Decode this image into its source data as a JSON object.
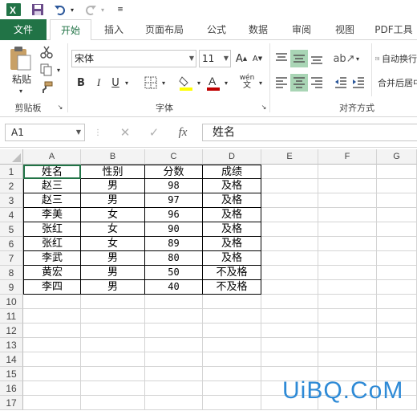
{
  "qab": {
    "app_icon": "excel-logo-icon",
    "save_icon": "save-icon",
    "undo_icon": "undo-icon",
    "redo_icon": "redo-icon",
    "customize_icon": "customize-qab-icon"
  },
  "tabs": [
    "文件",
    "开始",
    "插入",
    "页面布局",
    "公式",
    "数据",
    "审阅",
    "视图",
    "PDF工具"
  ],
  "ribbon": {
    "clipboard": {
      "paste_label": "粘贴",
      "group_label": "剪贴板"
    },
    "font": {
      "font_name": "宋体",
      "font_size": "11",
      "bold": "B",
      "italic": "I",
      "underline": "U",
      "phonetic": "wén",
      "group_label": "字体"
    },
    "alignment": {
      "wrap_label": "自动换行",
      "merge_label": "合并后居中",
      "group_label": "对齐方式"
    }
  },
  "formula_bar": {
    "name_box": "A1",
    "fx": "fx",
    "content": "姓名"
  },
  "columns": [
    "A",
    "B",
    "C",
    "D",
    "E",
    "F",
    "G"
  ],
  "rows": [
    "1",
    "2",
    "3",
    "4",
    "5",
    "6",
    "7",
    "8",
    "9",
    "10",
    "11",
    "12",
    "13",
    "14",
    "15",
    "16",
    "17"
  ],
  "table": [
    [
      "姓名",
      "性别",
      "分数",
      "成绩"
    ],
    [
      "赵三",
      "男",
      "98",
      "及格"
    ],
    [
      "赵三",
      "男",
      "97",
      "及格"
    ],
    [
      "李美",
      "女",
      "96",
      "及格"
    ],
    [
      "张红",
      "女",
      "90",
      "及格"
    ],
    [
      "张红",
      "女",
      "89",
      "及格"
    ],
    [
      "李武",
      "男",
      "80",
      "及格"
    ],
    [
      "黄宏",
      "男",
      "50",
      "不及格"
    ],
    [
      "李四",
      "男",
      "40",
      "不及格"
    ]
  ],
  "watermark": "UiBQ.CoM",
  "colors": {
    "excel_green": "#217346",
    "selected_align": "#a9d5b5",
    "font_color_red": "#c00000",
    "fill_yellow": "#ffff00",
    "watermark_blue": "#2e8ad6"
  }
}
